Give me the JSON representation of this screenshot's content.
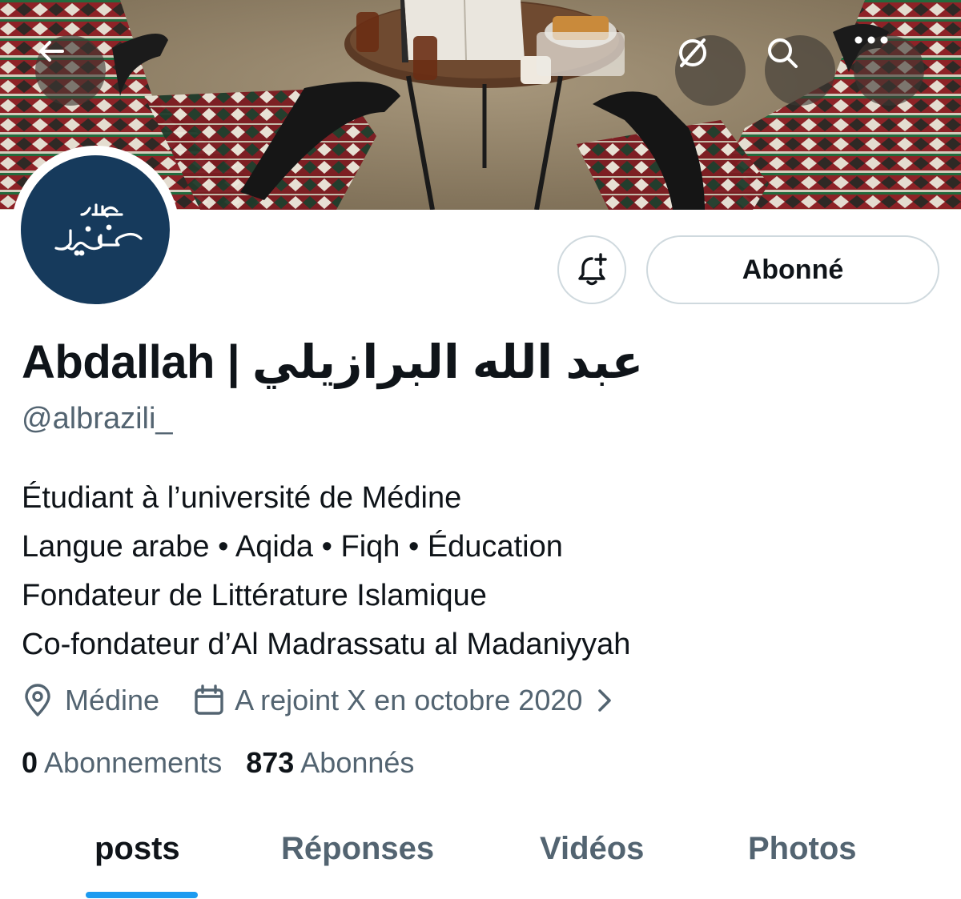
{
  "header": {
    "back_icon": "arrow-left-icon",
    "translate_icon": "translate-off-icon",
    "search_icon": "search-icon",
    "more_icon": "more-horizontal-icon"
  },
  "profile": {
    "avatar_text": "عبد الله البرازيلي",
    "display_name": "Abdallah | عبد الله البرازيلي",
    "handle": "@albrazili_",
    "bio": [
      "Étudiant à l’université de Médine",
      "Langue arabe • Aqida • Fiqh • Éducation",
      "Fondateur de Littérature Islamique",
      "Co-fondateur d’Al Madrassatu al Madaniyyah"
    ],
    "location": "Médine",
    "joined": "A rejoint X en octobre 2020",
    "following_count": "0",
    "following_label": "Abonnements",
    "followers_count": "873",
    "followers_label": "Abonnés"
  },
  "actions": {
    "follow_label": "Abonné",
    "notify_icon": "bell-plus-icon"
  },
  "tabs": [
    {
      "label": "posts",
      "active": true
    },
    {
      "label": "Réponses",
      "active": false
    },
    {
      "label": "Vidéos",
      "active": false
    },
    {
      "label": "Photos",
      "active": false
    }
  ],
  "colors": {
    "accent": "#1d9bf0",
    "text_primary": "#0f1419",
    "text_secondary": "#536471",
    "avatar_bg": "#163a5c"
  }
}
